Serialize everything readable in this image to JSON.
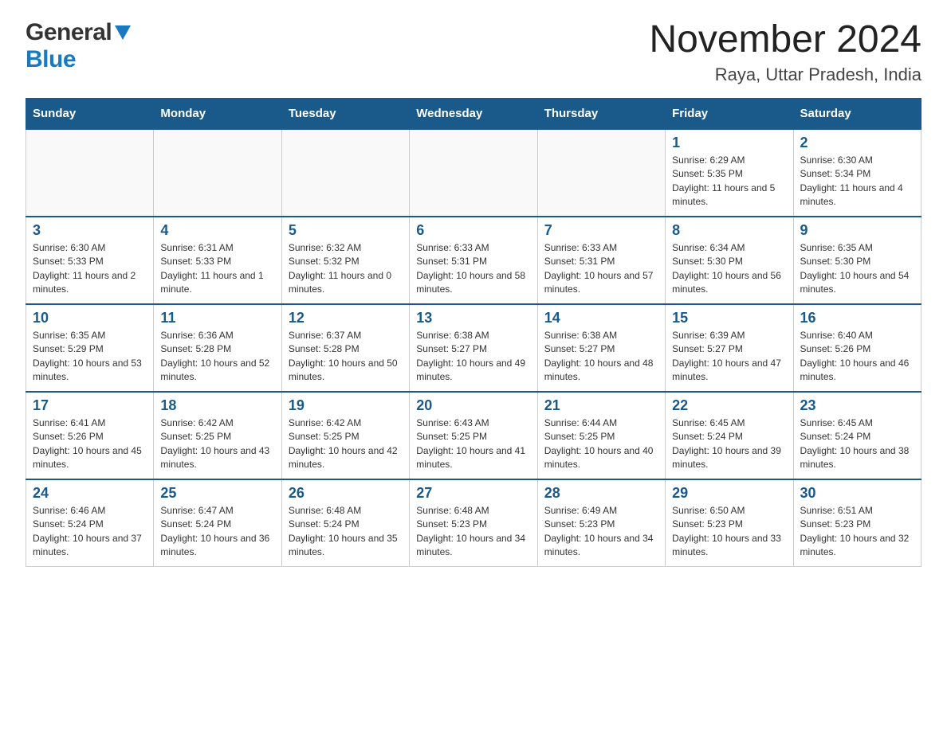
{
  "header": {
    "month_title": "November 2024",
    "location": "Raya, Uttar Pradesh, India",
    "logo_general": "General",
    "logo_blue": "Blue"
  },
  "days_of_week": [
    "Sunday",
    "Monday",
    "Tuesday",
    "Wednesday",
    "Thursday",
    "Friday",
    "Saturday"
  ],
  "weeks": [
    {
      "days": [
        {
          "number": "",
          "info": ""
        },
        {
          "number": "",
          "info": ""
        },
        {
          "number": "",
          "info": ""
        },
        {
          "number": "",
          "info": ""
        },
        {
          "number": "",
          "info": ""
        },
        {
          "number": "1",
          "info": "Sunrise: 6:29 AM\nSunset: 5:35 PM\nDaylight: 11 hours and 5 minutes."
        },
        {
          "number": "2",
          "info": "Sunrise: 6:30 AM\nSunset: 5:34 PM\nDaylight: 11 hours and 4 minutes."
        }
      ]
    },
    {
      "days": [
        {
          "number": "3",
          "info": "Sunrise: 6:30 AM\nSunset: 5:33 PM\nDaylight: 11 hours and 2 minutes."
        },
        {
          "number": "4",
          "info": "Sunrise: 6:31 AM\nSunset: 5:33 PM\nDaylight: 11 hours and 1 minute."
        },
        {
          "number": "5",
          "info": "Sunrise: 6:32 AM\nSunset: 5:32 PM\nDaylight: 11 hours and 0 minutes."
        },
        {
          "number": "6",
          "info": "Sunrise: 6:33 AM\nSunset: 5:31 PM\nDaylight: 10 hours and 58 minutes."
        },
        {
          "number": "7",
          "info": "Sunrise: 6:33 AM\nSunset: 5:31 PM\nDaylight: 10 hours and 57 minutes."
        },
        {
          "number": "8",
          "info": "Sunrise: 6:34 AM\nSunset: 5:30 PM\nDaylight: 10 hours and 56 minutes."
        },
        {
          "number": "9",
          "info": "Sunrise: 6:35 AM\nSunset: 5:30 PM\nDaylight: 10 hours and 54 minutes."
        }
      ]
    },
    {
      "days": [
        {
          "number": "10",
          "info": "Sunrise: 6:35 AM\nSunset: 5:29 PM\nDaylight: 10 hours and 53 minutes."
        },
        {
          "number": "11",
          "info": "Sunrise: 6:36 AM\nSunset: 5:28 PM\nDaylight: 10 hours and 52 minutes."
        },
        {
          "number": "12",
          "info": "Sunrise: 6:37 AM\nSunset: 5:28 PM\nDaylight: 10 hours and 50 minutes."
        },
        {
          "number": "13",
          "info": "Sunrise: 6:38 AM\nSunset: 5:27 PM\nDaylight: 10 hours and 49 minutes."
        },
        {
          "number": "14",
          "info": "Sunrise: 6:38 AM\nSunset: 5:27 PM\nDaylight: 10 hours and 48 minutes."
        },
        {
          "number": "15",
          "info": "Sunrise: 6:39 AM\nSunset: 5:27 PM\nDaylight: 10 hours and 47 minutes."
        },
        {
          "number": "16",
          "info": "Sunrise: 6:40 AM\nSunset: 5:26 PM\nDaylight: 10 hours and 46 minutes."
        }
      ]
    },
    {
      "days": [
        {
          "number": "17",
          "info": "Sunrise: 6:41 AM\nSunset: 5:26 PM\nDaylight: 10 hours and 45 minutes."
        },
        {
          "number": "18",
          "info": "Sunrise: 6:42 AM\nSunset: 5:25 PM\nDaylight: 10 hours and 43 minutes."
        },
        {
          "number": "19",
          "info": "Sunrise: 6:42 AM\nSunset: 5:25 PM\nDaylight: 10 hours and 42 minutes."
        },
        {
          "number": "20",
          "info": "Sunrise: 6:43 AM\nSunset: 5:25 PM\nDaylight: 10 hours and 41 minutes."
        },
        {
          "number": "21",
          "info": "Sunrise: 6:44 AM\nSunset: 5:25 PM\nDaylight: 10 hours and 40 minutes."
        },
        {
          "number": "22",
          "info": "Sunrise: 6:45 AM\nSunset: 5:24 PM\nDaylight: 10 hours and 39 minutes."
        },
        {
          "number": "23",
          "info": "Sunrise: 6:45 AM\nSunset: 5:24 PM\nDaylight: 10 hours and 38 minutes."
        }
      ]
    },
    {
      "days": [
        {
          "number": "24",
          "info": "Sunrise: 6:46 AM\nSunset: 5:24 PM\nDaylight: 10 hours and 37 minutes."
        },
        {
          "number": "25",
          "info": "Sunrise: 6:47 AM\nSunset: 5:24 PM\nDaylight: 10 hours and 36 minutes."
        },
        {
          "number": "26",
          "info": "Sunrise: 6:48 AM\nSunset: 5:24 PM\nDaylight: 10 hours and 35 minutes."
        },
        {
          "number": "27",
          "info": "Sunrise: 6:48 AM\nSunset: 5:23 PM\nDaylight: 10 hours and 34 minutes."
        },
        {
          "number": "28",
          "info": "Sunrise: 6:49 AM\nSunset: 5:23 PM\nDaylight: 10 hours and 34 minutes."
        },
        {
          "number": "29",
          "info": "Sunrise: 6:50 AM\nSunset: 5:23 PM\nDaylight: 10 hours and 33 minutes."
        },
        {
          "number": "30",
          "info": "Sunrise: 6:51 AM\nSunset: 5:23 PM\nDaylight: 10 hours and 32 minutes."
        }
      ]
    }
  ]
}
